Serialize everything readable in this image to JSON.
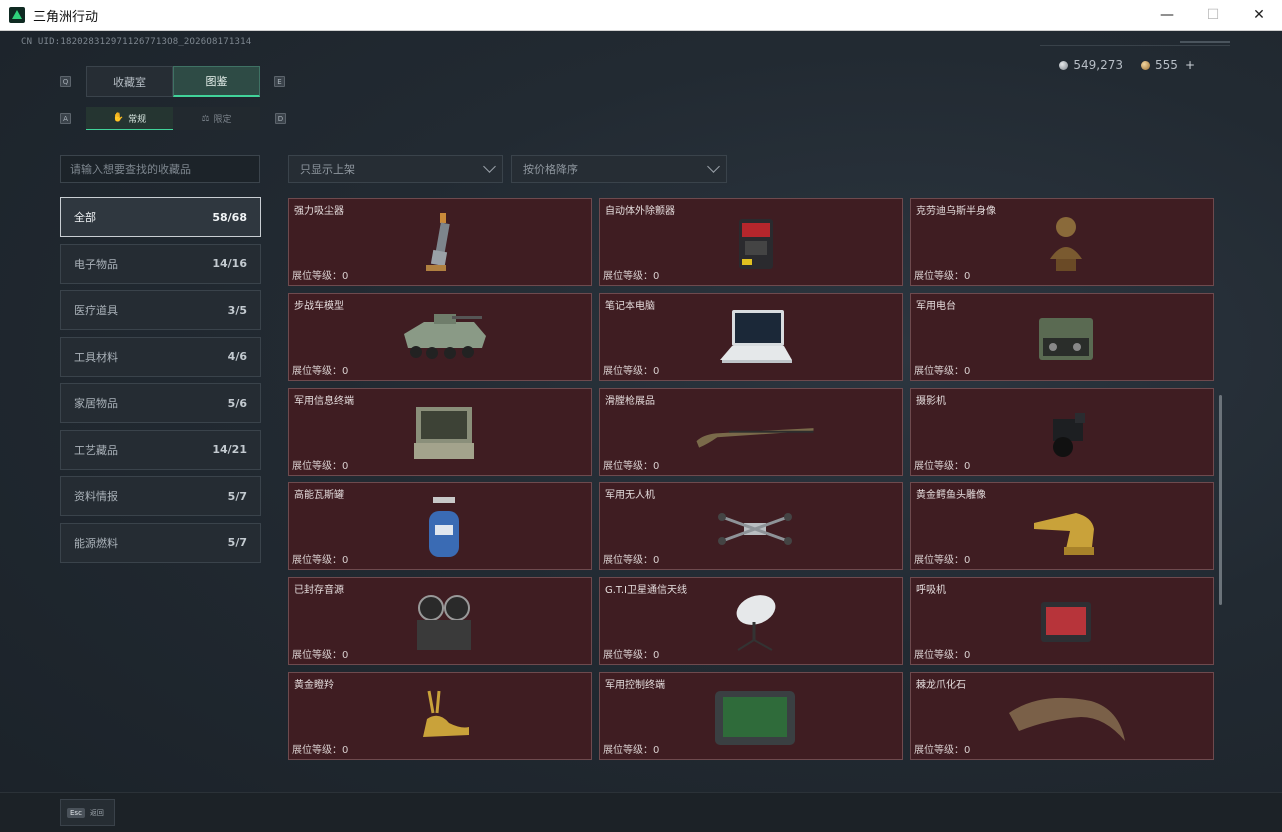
{
  "window": {
    "title": "三角洲行动",
    "minimize": "—",
    "maximize": "☐",
    "close": "✕"
  },
  "uid": "CN UID:1820283129711267713O8_2O26O8171314",
  "currency": {
    "silver": "549,273",
    "gold": "555",
    "plus": "+"
  },
  "keyhints": {
    "q": "Q",
    "e": "E",
    "a": "A",
    "d": "D"
  },
  "tabs_main": [
    {
      "label": "收藏室"
    },
    {
      "label": "图鉴"
    }
  ],
  "tabs_sub": [
    {
      "label": "常规",
      "icon": "✋"
    },
    {
      "label": "限定",
      "icon": "⚖"
    }
  ],
  "search": {
    "placeholder": "请输入想要查找的收藏品"
  },
  "filters": {
    "shelf": "只显示上架",
    "sort": "按价格降序"
  },
  "categories": [
    {
      "label": "全部",
      "count": "58/68"
    },
    {
      "label": "电子物品",
      "count": "14/16"
    },
    {
      "label": "医疗道具",
      "count": "3/5"
    },
    {
      "label": "工具材料",
      "count": "4/6"
    },
    {
      "label": "家居物品",
      "count": "5/6"
    },
    {
      "label": "工艺藏品",
      "count": "14/21"
    },
    {
      "label": "资料情报",
      "count": "5/7"
    },
    {
      "label": "能源燃料",
      "count": "5/7"
    }
  ],
  "level_label": "展位等级：",
  "items": [
    {
      "name": "强力吸尘器",
      "level": "0",
      "icon": "vacuum-icon"
    },
    {
      "name": "自动体外除颤器",
      "level": "0",
      "icon": "defibrillator-icon"
    },
    {
      "name": "克劳迪乌斯半身像",
      "level": "0",
      "icon": "bust-icon"
    },
    {
      "name": "步战车模型",
      "level": "0",
      "icon": "ifv-model-icon"
    },
    {
      "name": "笔记本电脑",
      "level": "0",
      "icon": "laptop-icon"
    },
    {
      "name": "军用电台",
      "level": "0",
      "icon": "radio-icon"
    },
    {
      "name": "军用信息终端",
      "level": "0",
      "icon": "terminal-icon"
    },
    {
      "name": "滑膛枪展品",
      "level": "0",
      "icon": "musket-icon"
    },
    {
      "name": "摄影机",
      "level": "0",
      "icon": "camera-icon"
    },
    {
      "name": "高能瓦斯罐",
      "level": "0",
      "icon": "gas-tank-icon"
    },
    {
      "name": "军用无人机",
      "level": "0",
      "icon": "drone-icon"
    },
    {
      "name": "黄金鳄鱼头雕像",
      "level": "0",
      "icon": "crocodile-statue-icon"
    },
    {
      "name": "已封存音源",
      "level": "0",
      "icon": "reel-recorder-icon"
    },
    {
      "name": "G.T.I卫星通信天线",
      "level": "0",
      "icon": "satellite-dish-icon"
    },
    {
      "name": "呼吸机",
      "level": "0",
      "icon": "ventilator-icon"
    },
    {
      "name": "黄金瞪羚",
      "level": "0",
      "icon": "golden-gazelle-icon"
    },
    {
      "name": "军用控制终端",
      "level": "0",
      "icon": "control-terminal-icon"
    },
    {
      "name": "棘龙爪化石",
      "level": "0",
      "icon": "claw-fossil-icon"
    }
  ],
  "bottom": {
    "esc_key": "Esc",
    "esc_label": "返回"
  }
}
